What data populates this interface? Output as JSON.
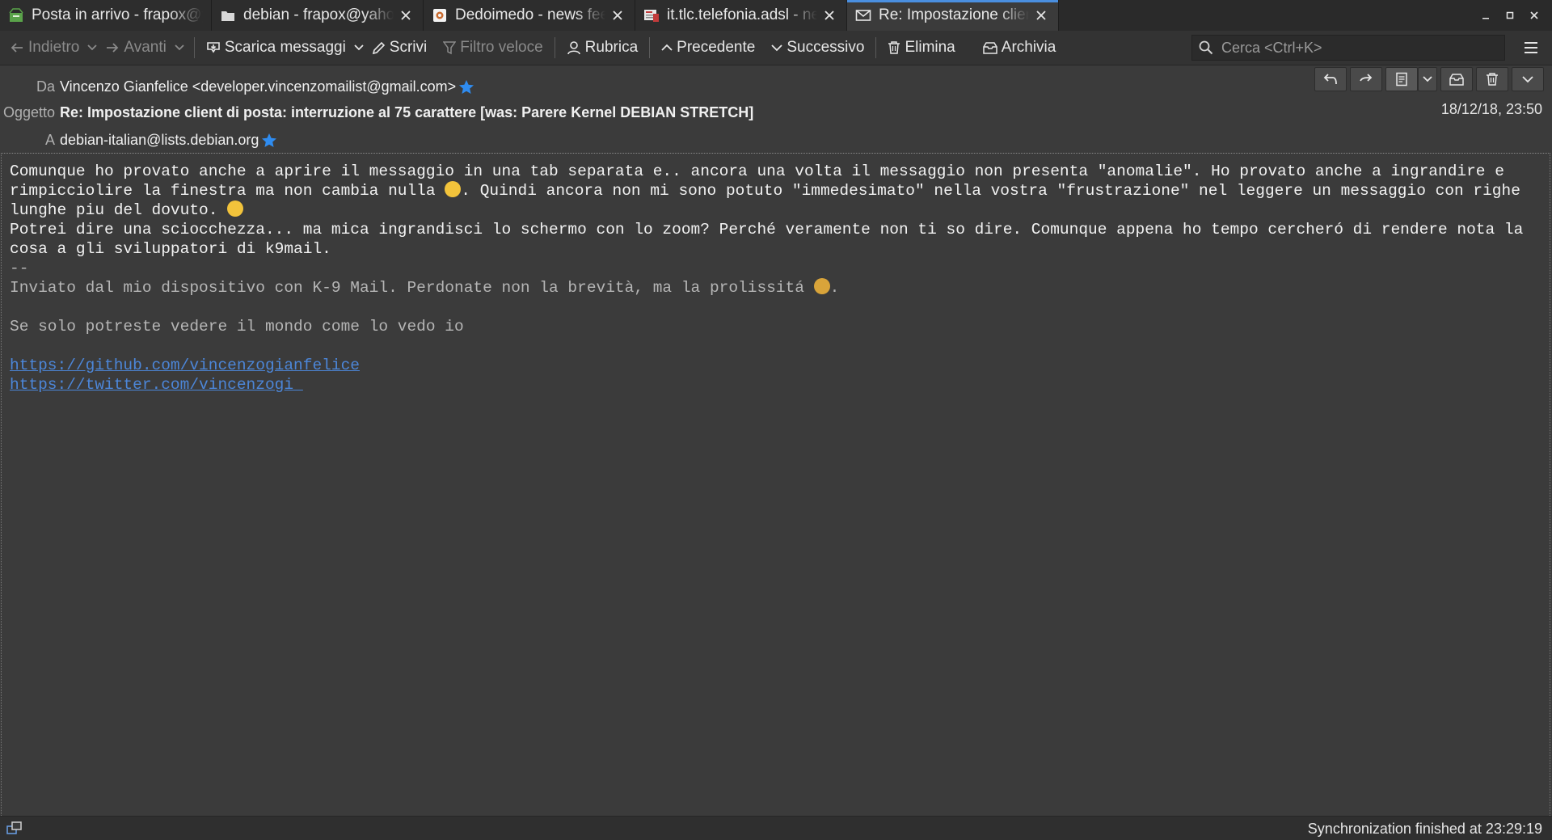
{
  "tabs": [
    {
      "label": "Posta in arrivo - frapox@yahoo.it",
      "icon": "inbox-icon"
    },
    {
      "label": "debian - frapox@yahoo.it",
      "icon": "folder-icon"
    },
    {
      "label": "Dedoimedo - news feed",
      "icon": "feed-icon"
    },
    {
      "label": "it.tlc.telefonia.adsl - newsgroup",
      "icon": "newsgroup-icon"
    },
    {
      "label": "Re: Impostazione client di posta",
      "icon": "envelope-icon"
    }
  ],
  "toolbar": {
    "back": "Indietro",
    "forward": "Avanti",
    "get_messages": "Scarica messaggi",
    "write": "Scrivi",
    "quick_filter": "Filtro veloce",
    "address_book": "Rubrica",
    "previous": "Precedente",
    "next": "Successivo",
    "delete": "Elimina",
    "archive": "Archivia",
    "search_placeholder": "Cerca <Ctrl+K>"
  },
  "header": {
    "from_label": "Da",
    "from_value": "Vincenzo Gianfelice <developer.vincenzomailist@gmail.com>",
    "subject_label": "Oggetto",
    "subject_value": "Re: Impostazione client di posta: interruzione al 75 carattere [was: Parere Kernel DEBIAN STRETCH]",
    "to_label": "A",
    "to_value": "debian-italian@lists.debian.org",
    "date": "18/12/18, 23:50"
  },
  "body": {
    "p1_a": "Comunque ho provato anche a aprire il messaggio in una tab separata e.. ancora una volta il messaggio non presenta \"anomalie\". Ho provato anche a ingrandire e rimpicciolire la finestra ma non cambia nulla ",
    "p1_b": ". Quindi ancora non mi sono potuto \"immedesimato\" nella vostra \"frustrazione\" nel leggere un messaggio con righe lunghe piu del dovuto. ",
    "p2": "Potrei dire una sciocchezza... ma mica ingrandisci lo schermo con lo zoom? Perché veramente non ti so dire. Comunque appena ho tempo cercheró di rendere nota la cosa a gli sviluppatori di k9mail.",
    "sig_sep": "--",
    "sig_a": "Inviato dal mio dispositivo con K-9 Mail. Perdonate non la brevità, ma la prolissitá ",
    "sig_b": ".",
    "sig_quote": "Se solo potreste vedere il mondo come lo vedo io",
    "link1": "https://github.com/vincenzogianfelice",
    "link2": "https://twitter.com/vincenzogi_"
  },
  "status": {
    "text": "Synchronization finished at 23:29:19"
  },
  "colors": {
    "accent": "#4a8fe0",
    "link": "#4c86d8",
    "star": "#2f8cf0",
    "background": "#3b3b3b"
  }
}
